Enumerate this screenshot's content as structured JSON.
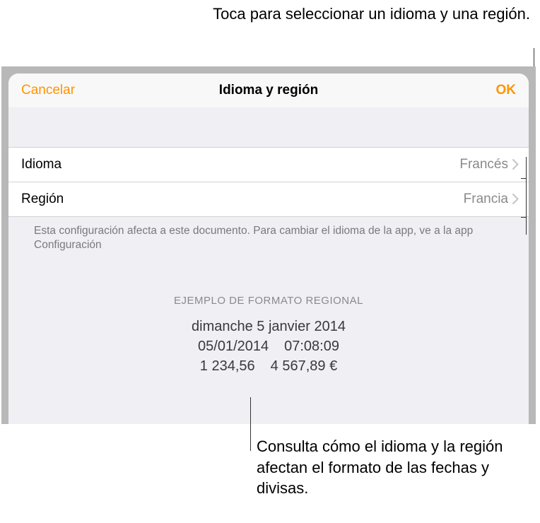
{
  "callouts": {
    "top": "Toca para seleccionar un idioma y una región.",
    "bottom": "Consulta cómo el idioma y la región afectan el formato de las fechas y divisas."
  },
  "nav": {
    "cancel": "Cancelar",
    "title": "Idioma y región",
    "ok": "OK"
  },
  "rows": {
    "language": {
      "label": "Idioma",
      "value": "Francés"
    },
    "region": {
      "label": "Región",
      "value": "Francia"
    }
  },
  "footer_note": "Esta configuración afecta a este documento. Para cambiar el idioma de la app, ve a la app Configuración",
  "example": {
    "header": "EJEMPLO DE FORMATO REGIONAL",
    "date_long": "dimanche 5 janvier 2014",
    "date_short": "05/01/2014",
    "time": "07:08:09",
    "number": "1 234,56",
    "currency": "4 567,89 €"
  }
}
